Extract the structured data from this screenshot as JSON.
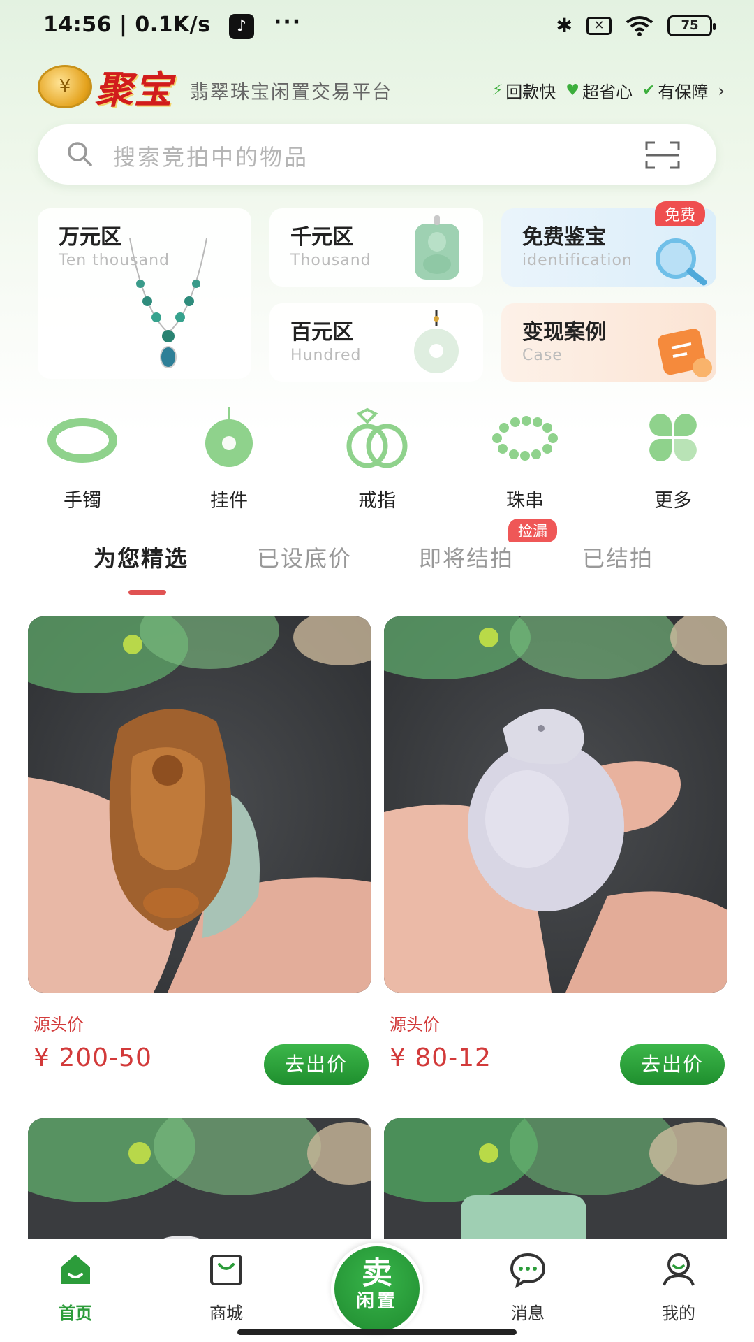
{
  "status_bar": {
    "time": "14:56 | 0.1K/s",
    "tiktok_glyph": "♪",
    "more": "···",
    "bluetooth_glyph": "✱",
    "sim_glyph": "✕",
    "battery": "75"
  },
  "header": {
    "logo_text": "聚宝",
    "slogan": "翡翠珠宝闲置交易平台",
    "features": [
      {
        "icon": "lightning-icon",
        "glyph": "⚡",
        "label": "回款快"
      },
      {
        "icon": "heart-icon",
        "glyph": "♥",
        "label": "超省心"
      },
      {
        "icon": "shield-check-icon",
        "glyph": "✔",
        "label": "有保障"
      }
    ],
    "more_arrow": "›"
  },
  "search": {
    "placeholder": "搜索竞拍中的物品"
  },
  "zones": [
    {
      "title": "万元区",
      "subtitle": "Ten thousand"
    },
    {
      "title": "千元区",
      "subtitle": "Thousand"
    },
    {
      "title": "免费鉴宝",
      "subtitle": "identification",
      "badge": "免费"
    },
    {
      "title": "百元区",
      "subtitle": "Hundred"
    },
    {
      "title": "变现案例",
      "subtitle": "Case"
    }
  ],
  "categories": [
    {
      "label": "手镯",
      "icon": "bangle-icon"
    },
    {
      "label": "挂件",
      "icon": "pendant-icon"
    },
    {
      "label": "戒指",
      "icon": "ring-icon"
    },
    {
      "label": "珠串",
      "icon": "bead-bracelet-icon"
    },
    {
      "label": "更多",
      "icon": "clover-more-icon"
    }
  ],
  "tabs": [
    {
      "label": "为您精选",
      "active": true
    },
    {
      "label": "已设底价",
      "active": false
    },
    {
      "label": "即将结拍",
      "active": false,
      "badge": "捡漏"
    },
    {
      "label": "已结拍",
      "active": false
    }
  ],
  "products": [
    {
      "price_label": "源头价",
      "price": "¥ 200-50",
      "button": "去出价"
    },
    {
      "price_label": "源头价",
      "price": "¥ 80-12",
      "button": "去出价"
    }
  ],
  "bottom_nav": {
    "items": [
      {
        "label": "首页",
        "active": true
      },
      {
        "label": "商城",
        "active": false
      },
      {
        "label": "消息",
        "active": false
      },
      {
        "label": "我的",
        "active": false
      }
    ],
    "sell_main": "卖",
    "sell_sub": "闲置"
  },
  "colors": {
    "accent_green": "#2c9c3a",
    "price_red": "#d23a3a",
    "badge_red": "#ef4f4f",
    "brand_red": "#d11c1c"
  }
}
